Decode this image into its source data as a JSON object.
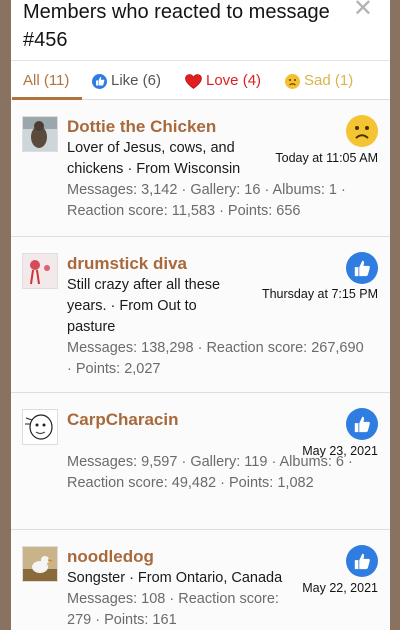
{
  "dialog": {
    "title": "Members who reacted to message #456",
    "close_glyph": "✕"
  },
  "tabs": [
    {
      "label": "All (11)",
      "active": true
    },
    {
      "label": "Like (6)",
      "icon": "like-icon"
    },
    {
      "label": "Love (4)",
      "icon": "love-icon"
    },
    {
      "label": "Sad (1)",
      "icon": "sad-icon"
    }
  ],
  "members": [
    {
      "name": "Dottie the Chicken",
      "about": "Lover of Jesus, cows, and chickens · From Wisconsin",
      "stats": "Messages: 3,142 · Gallery: 16 · Albums: 1 · Reaction score: 11,583 · Points: 656",
      "time": "Today at 11:05 AM",
      "reaction": "sad-icon"
    },
    {
      "name": "drumstick diva",
      "about": "Still crazy after all these years. · From Out to pasture",
      "stats": "Messages: 138,298 · Reaction score: 267,690 · Points: 2,027",
      "time": "Thursday at 7:15 PM",
      "reaction": "like-icon"
    },
    {
      "name": "CarpCharacin",
      "about": "",
      "stats": "Messages: 9,597 · Gallery: 119 · Albums: 6 · Reaction score: 49,482 · Points: 1,082",
      "time": "May 23, 2021",
      "reaction": "like-icon"
    },
    {
      "name": "noodledog",
      "about": "Songster · From Ontario, Canada",
      "stats": "Messages: 108 · Reaction score: 279 · Points: 161",
      "time": "May 22, 2021",
      "reaction": "like-icon"
    }
  ],
  "colors": {
    "accent": "#b0733c",
    "name": "#a8693c",
    "like": "#2f7de1",
    "love": "#e02020",
    "sad": "#f5c433"
  }
}
